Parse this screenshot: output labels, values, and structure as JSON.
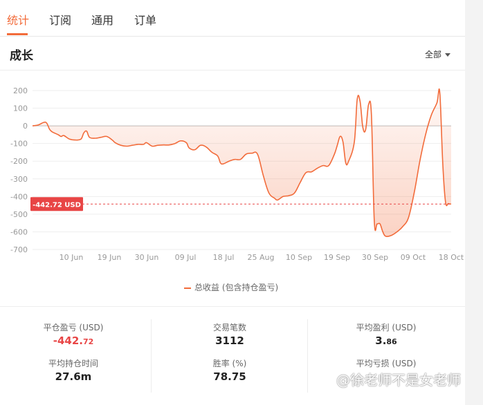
{
  "tabs": [
    {
      "label": "统计"
    },
    {
      "label": "订阅"
    },
    {
      "label": "通用"
    },
    {
      "label": "订单"
    }
  ],
  "section": {
    "title": "成长",
    "filter_label": "全部"
  },
  "current_value_tag": "-442.72 USD",
  "legend_label": "总收益 (包含持仓盈亏)",
  "colors": {
    "accent": "#f26b3a",
    "negative": "#e84545",
    "tag_bg": "#e84545"
  },
  "chart_data": {
    "type": "area",
    "series": [
      {
        "name": "总收益 (包含持仓盈亏)",
        "points": [
          [
            "06-01",
            0
          ],
          [
            "06-03",
            5
          ],
          [
            "06-05",
            20
          ],
          [
            "06-06",
            15
          ],
          [
            "06-07",
            -20
          ],
          [
            "06-08",
            -35
          ],
          [
            "06-10",
            -50
          ],
          [
            "06-11",
            -60
          ],
          [
            "06-12",
            -55
          ],
          [
            "06-14",
            -75
          ],
          [
            "06-16",
            -80
          ],
          [
            "06-18",
            -75
          ],
          [
            "06-19",
            -40
          ],
          [
            "06-20",
            -30
          ],
          [
            "06-21",
            -65
          ],
          [
            "06-23",
            -70
          ],
          [
            "06-25",
            -65
          ],
          [
            "06-27",
            -60
          ],
          [
            "06-29",
            -80
          ],
          [
            "06-30",
            -95
          ],
          [
            "07-02",
            -110
          ],
          [
            "07-04",
            -115
          ],
          [
            "07-06",
            -110
          ],
          [
            "07-08",
            -105
          ],
          [
            "07-10",
            -105
          ],
          [
            "07-11",
            -95
          ],
          [
            "07-13",
            -115
          ],
          [
            "07-15",
            -110
          ],
          [
            "07-17",
            -108
          ],
          [
            "07-19",
            -108
          ],
          [
            "07-21",
            -100
          ],
          [
            "07-23",
            -85
          ],
          [
            "07-25",
            -95
          ],
          [
            "07-26",
            -125
          ],
          [
            "07-28",
            -135
          ],
          [
            "07-30",
            -110
          ],
          [
            "08-01",
            -120
          ],
          [
            "08-03",
            -150
          ],
          [
            "08-05",
            -170
          ],
          [
            "08-06",
            -210
          ],
          [
            "08-07",
            -215
          ],
          [
            "08-09",
            -200
          ],
          [
            "08-11",
            -190
          ],
          [
            "08-13",
            -190
          ],
          [
            "08-15",
            -160
          ],
          [
            "08-17",
            -155
          ],
          [
            "08-19",
            -160
          ],
          [
            "08-21",
            -280
          ],
          [
            "08-23",
            -380
          ],
          [
            "08-25",
            -410
          ],
          [
            "08-26",
            -420
          ],
          [
            "08-28",
            -400
          ],
          [
            "08-30",
            -395
          ],
          [
            "09-01",
            -380
          ],
          [
            "09-03",
            -320
          ],
          [
            "09-05",
            -265
          ],
          [
            "09-07",
            -260
          ],
          [
            "09-09",
            -240
          ],
          [
            "09-11",
            -225
          ],
          [
            "09-13",
            -225
          ],
          [
            "09-15",
            -160
          ],
          [
            "09-16",
            -110
          ],
          [
            "09-17",
            -60
          ],
          [
            "09-18",
            -90
          ],
          [
            "09-19",
            -210
          ],
          [
            "09-20",
            -200
          ],
          [
            "09-22",
            -90
          ],
          [
            "09-23",
            150
          ],
          [
            "09-24",
            140
          ],
          [
            "09-25",
            -10
          ],
          [
            "09-26",
            -20
          ],
          [
            "09-27",
            120
          ],
          [
            "09-28",
            60
          ],
          [
            "09-29",
            -540
          ],
          [
            "09-30",
            -555
          ],
          [
            "10-01",
            -555
          ],
          [
            "10-02",
            -600
          ],
          [
            "10-03",
            -625
          ],
          [
            "10-05",
            -620
          ],
          [
            "10-07",
            -600
          ],
          [
            "10-09",
            -570
          ],
          [
            "10-11",
            -520
          ],
          [
            "10-13",
            -380
          ],
          [
            "10-15",
            -200
          ],
          [
            "10-17",
            -50
          ],
          [
            "10-19",
            60
          ],
          [
            "10-21",
            130
          ],
          [
            "10-22",
            190
          ],
          [
            "10-23",
            -200
          ],
          [
            "10-24",
            -430
          ],
          [
            "10-25",
            -440
          ],
          [
            "10-26",
            -443
          ]
        ]
      }
    ],
    "x_ticks": [
      "10 Jun",
      "19 Jun",
      "30 Jun",
      "09 Jul",
      "18 Jul",
      "25 Aug",
      "10 Sep",
      "19 Sep",
      "30 Sep",
      "09 Oct",
      "18 Oct"
    ],
    "y_ticks": [
      200,
      100,
      0,
      -100,
      -200,
      -300,
      -400,
      -500,
      -600,
      -700
    ],
    "ylim": [
      -700,
      200
    ],
    "reference_line": -442.72,
    "grid": true,
    "legend": "bottom-center"
  },
  "stats": [
    {
      "label": "平仓盈亏 (USD)",
      "value_main": "-442.",
      "value_small": "72"
    },
    {
      "label": "交易笔数",
      "value_main": "3112",
      "value_small": ""
    },
    {
      "label": "平均盈利 (USD)",
      "value_main": "3.",
      "value_small": "86"
    },
    {
      "label": "平均持仓时间",
      "value_main": "27.6m",
      "value_small": ""
    },
    {
      "label": "胜率 (%)",
      "value_main": "78.75",
      "value_small": ""
    },
    {
      "label": "平均亏损 (USD)",
      "value_main": "",
      "value_small": ""
    }
  ],
  "watermark": "@徐老师不是女老师"
}
